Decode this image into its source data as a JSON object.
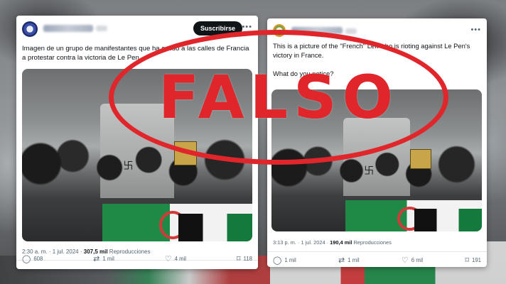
{
  "left_tweet": {
    "subscribe_label": "Suscribirse",
    "more_icon": "more-dots-icon",
    "text": "Imagen de un grupo de manifestantes que ha salido a las calles de Francia a protestar contra la victoria de Le Pen.",
    "time": "2:30 a. m.",
    "date": "1 jul. 2024",
    "views": "307,5 mil",
    "views_label": "Reproducciones",
    "replies": "608",
    "reposts": "1 mil",
    "likes": "4 mil",
    "bookmarks": "118"
  },
  "right_tweet": {
    "more_icon": "more-dots-icon",
    "text_line1": "This is a picture of the \"French\" Left who is rioting against Le Pen's victory in France.",
    "text_line2": "What do you notice?",
    "time": "3:13 p. m.",
    "date": "1 jul. 2024",
    "views": "190,4 mil",
    "views_label": "Reproducciones",
    "replies": "1 mil",
    "reposts": "1 mil",
    "likes": "6 mil",
    "bookmarks": "191"
  },
  "stamp": {
    "label": "FALSO",
    "color": "#e0262b"
  },
  "icons": {
    "reply": "reply-icon",
    "repost": "repost-icon",
    "like": "heart-icon",
    "bookmark": "bookmark-icon"
  }
}
